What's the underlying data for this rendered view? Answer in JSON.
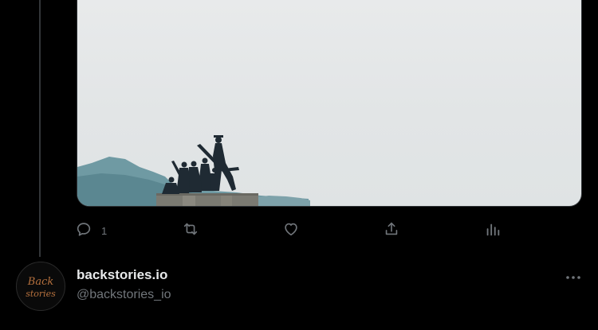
{
  "thread": {
    "media": {
      "icon": "photo-statue-monument"
    },
    "actions": {
      "reply": {
        "icon": "reply-icon",
        "count": "1"
      },
      "retweet": {
        "icon": "retweet-icon",
        "count": ""
      },
      "like": {
        "icon": "heart-icon",
        "count": ""
      },
      "share": {
        "icon": "share-icon"
      },
      "analytics": {
        "icon": "analytics-icon"
      }
    }
  },
  "next_tweet": {
    "author": {
      "display_name": "backstories.io",
      "handle": "@backstories_io",
      "avatar_text": "Back stories"
    },
    "more_icon": "more-options-icon"
  },
  "colors": {
    "background": "#000000",
    "text_primary": "#e7e9ea",
    "text_secondary": "#71767b",
    "thread_line": "#333639"
  }
}
